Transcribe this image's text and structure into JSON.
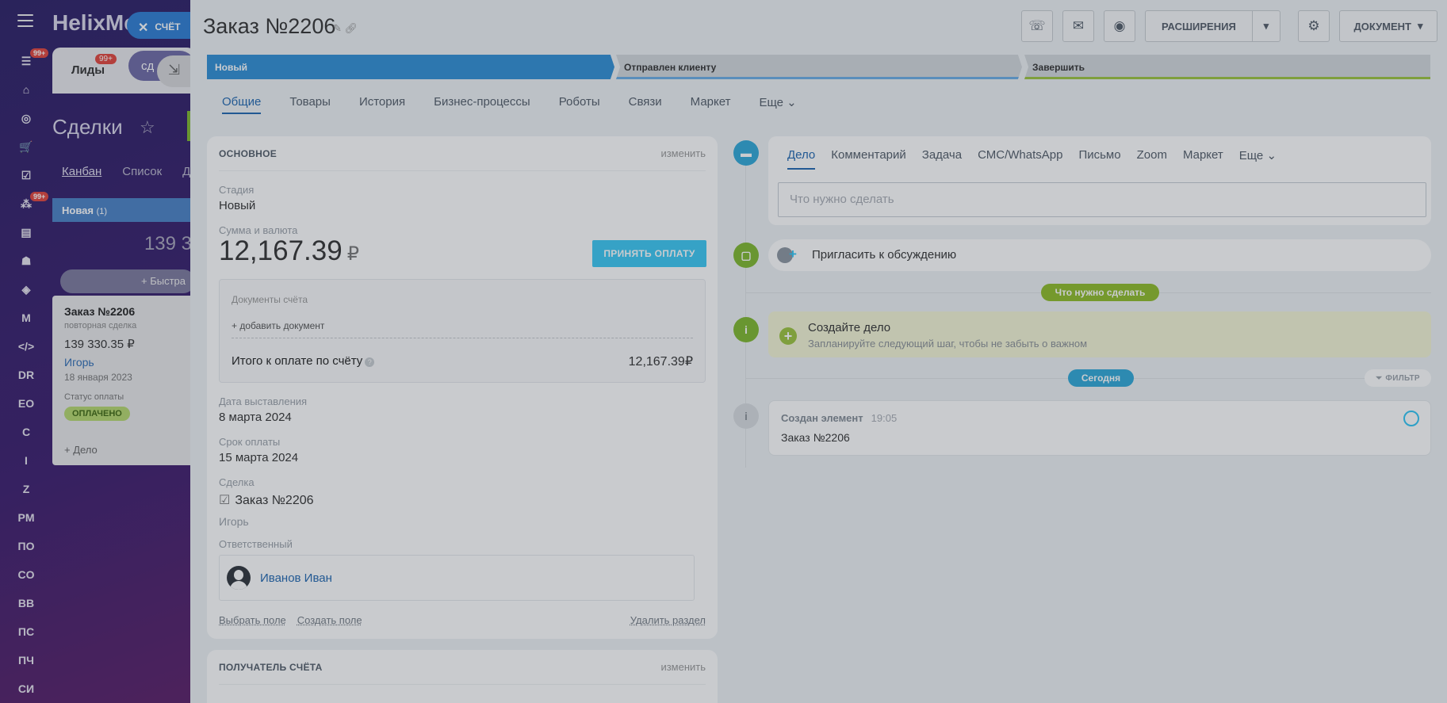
{
  "left_nav": {
    "badge1": "99+",
    "badge2": "99+",
    "items": [
      "DR",
      "EO",
      "C",
      "I",
      "Z",
      "PM",
      "ПО",
      "CO",
      "BB",
      "ПС",
      "ПЧ",
      "СИ"
    ]
  },
  "crm_bg": {
    "brand": "HelixMec",
    "tab_leads": "Лиды",
    "tab_leads_badge": "99+",
    "tab_deals_short": "сд",
    "title": "Сделки",
    "views": [
      "Канбан",
      "Список",
      "Д"
    ],
    "column": {
      "name": "Новая",
      "count": "(1)",
      "sum": "139 3",
      "quick": "Быстра"
    },
    "card": {
      "title": "Заказ №2206",
      "subtitle": "повторная сделка",
      "price": "139 330.35 ₽",
      "contact": "Игорь",
      "date": "18 января 2023",
      "status_label": "Статус оплаты",
      "status": "ОПЛАЧЕНО",
      "add": "+ Дело"
    }
  },
  "slider_tab": {
    "label": "СЧЁТ"
  },
  "header": {
    "title": "Заказ №2206",
    "extensions": "РАСШИРЕНИЯ",
    "document": "ДОКУМЕНТ"
  },
  "stages": [
    {
      "label": "Новый"
    },
    {
      "label": "Отправлен клиенту"
    },
    {
      "label": "Завершить"
    }
  ],
  "tabs": [
    "Общие",
    "Товары",
    "История",
    "Бизнес-процессы",
    "Роботы",
    "Связи",
    "Маркет",
    "Еще"
  ],
  "main": {
    "section_title": "ОСНОВНОЕ",
    "edit": "изменить",
    "stage_label": "Стадия",
    "stage_value": "Новый",
    "sum_label": "Сумма и валюта",
    "amount": "12,167.39",
    "currency": "₽",
    "pay_button": "ПРИНЯТЬ ОПЛАТУ",
    "docs_label": "Документы счёта",
    "add_doc": "+ добавить документ",
    "total_label": "Итого к оплате по счёту",
    "total_value": "12,167.39₽",
    "issue_label": "Дата выставления",
    "issue_value": "8 марта 2024",
    "due_label": "Срок оплаты",
    "due_value": "15 марта 2024",
    "deal_label": "Сделка",
    "deal_value": "Заказ №2206",
    "contact": "Игорь",
    "resp_label": "Ответственный",
    "resp_name": "Иванов Иван",
    "choose_field": "Выбрать поле",
    "create_field": "Создать поле",
    "delete_section": "Удалить раздел",
    "section2_title": "ПОЛУЧАТЕЛЬ СЧЁТА",
    "section2_edit": "изменить"
  },
  "timeline": {
    "tabs": [
      "Дело",
      "Комментарий",
      "Задача",
      "СМС/WhatsApp",
      "Письмо",
      "Zoom",
      "Маркет",
      "Еще"
    ],
    "placeholder": "Что нужно сделать",
    "invite": "Пригласить к обсуждению",
    "todo_pill": "Что нужно сделать",
    "create_title": "Создайте дело",
    "create_sub": "Запланируйте следующий шаг, чтобы не забыть о важном",
    "today": "Сегодня",
    "filter": "ФИЛЬТР",
    "event_title": "Создан элемент",
    "event_time": "19:05",
    "event_body": "Заказ №2206"
  },
  "colors": {
    "accent": "#2f8fd6",
    "green": "#9cc43e",
    "pay": "#3bc8f5"
  }
}
